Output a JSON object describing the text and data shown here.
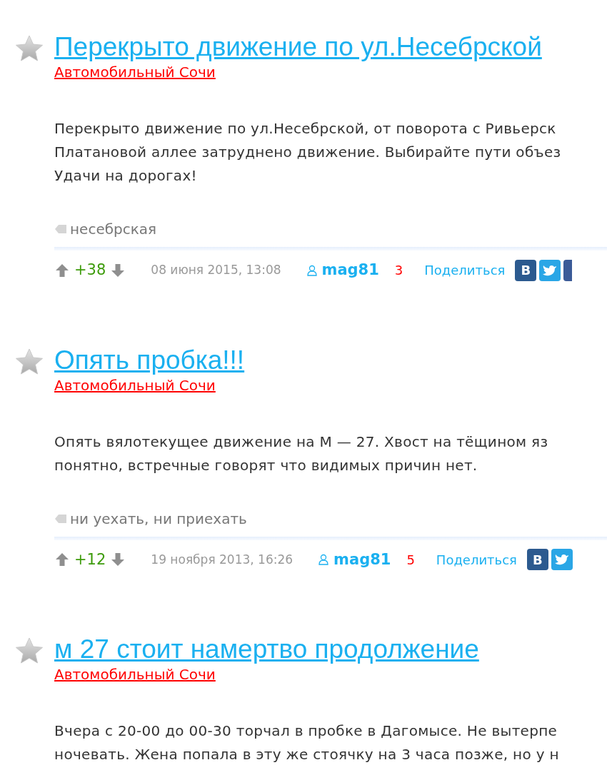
{
  "posts": [
    {
      "title": "Перекрыто движение по ул.Несебрской",
      "category": "Автомобильный Сочи",
      "body_lines": [
        "Перекрыто движение по ул.Несебрской, от поворота с Ривьерск",
        "Платановой аллее затруднено движение. Выбирайте пути объез",
        "Удачи на дорогах!"
      ],
      "tag": "несебрская",
      "score": "+38",
      "date": "08 июня 2015, 13:08",
      "author": "mag81",
      "comments": "3",
      "share": "Поделиться",
      "social": [
        {
          "kind": "vk",
          "letter": "В"
        },
        {
          "kind": "twitter"
        },
        {
          "kind": "facebook"
        }
      ]
    },
    {
      "title": "Опять пробка!!!",
      "category": "Автомобильный Сочи",
      "body_lines": [
        "Опять вялотекущее движение на М — 27. Хвост на тёщином яз",
        "понятно, встречные говорят что видимых причин нет."
      ],
      "tag": "ни уехать, ни приехать",
      "score": "+12",
      "date": "19 ноября 2013, 16:26",
      "author": "mag81",
      "comments": "5",
      "share": "Поделиться",
      "social": [
        {
          "kind": "vk",
          "letter": "В"
        },
        {
          "kind": "twitter"
        }
      ]
    },
    {
      "title": "м 27 стоит намертво продолжение",
      "category": "Автомобильный Сочи",
      "body_lines": [
        "Вчера с 20-00 до 00-30 торчал в пробке в Дагомысе. Не вытерпе",
        "ночевать. Жена попала в эту же стоячку на 3 часа позже, но у н"
      ]
    }
  ]
}
